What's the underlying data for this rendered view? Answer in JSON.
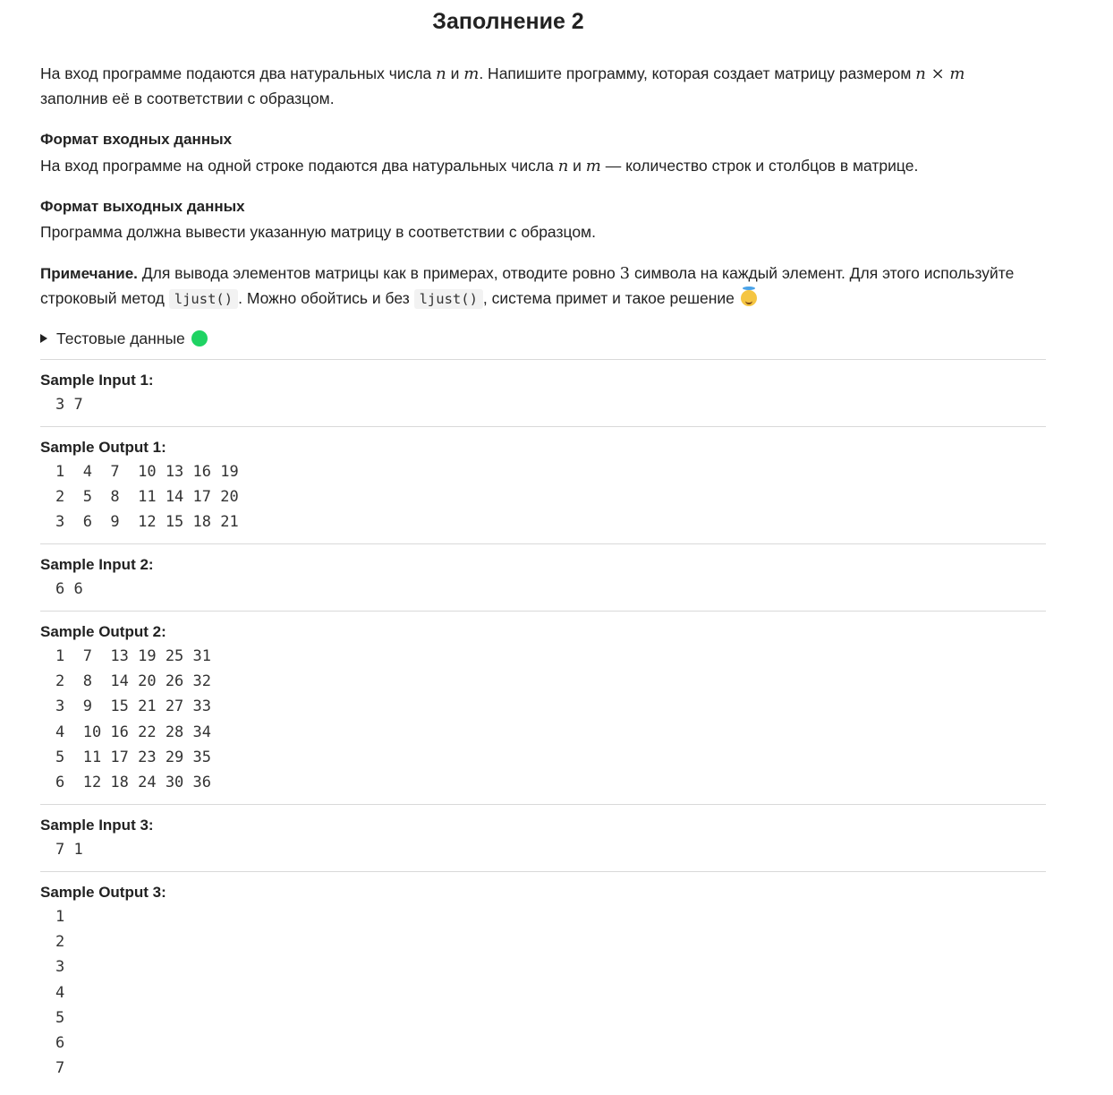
{
  "title": "Заполнение 2",
  "intro": {
    "text1": "На вход программе подаются два натуральных числа ",
    "n": "n",
    "and": " и ",
    "m": "m",
    "text2": ". Напишите программу, которая создает матрицу размером ",
    "times": " × ",
    "line2": "заполнив её в соответствии с образцом."
  },
  "input_format": {
    "heading": "Формат входных данных",
    "text1": "На вход программе на одной строке подаются два натуральных числа ",
    "n": "n",
    "and": " и ",
    "m": "m",
    "text2": " — количество строк и столбцов в матрице."
  },
  "output_format": {
    "heading": "Формат выходных данных",
    "text": "Программа должна вывести указанную матрицу в соответствии с образцом."
  },
  "note": {
    "label": "Примечание.",
    "text1": " Для вывода элементов матрицы как в примерах, отводите ровно ",
    "num": "3",
    "text2": " символа на каждый элемент. Для этого используйте",
    "line2_a": "строковый метод ",
    "code1": "ljust()",
    "line2_b": ". Можно обойтись и без ",
    "code2": "ljust()",
    "line2_c": ", система примет и такое решение",
    "emoji_icon": "smiling-face-with-halo-icon"
  },
  "test_data": {
    "label": "Тестовые данные",
    "status_color": "#1fd363"
  },
  "samples": [
    {
      "label": "Sample Input 1:",
      "text": "3 7"
    },
    {
      "label": "Sample Output 1:",
      "text": "1  4  7  10 13 16 19\n2  5  8  11 14 17 20\n3  6  9  12 15 18 21"
    },
    {
      "label": "Sample Input 2:",
      "text": "6 6"
    },
    {
      "label": "Sample Output 2:",
      "text": "1  7  13 19 25 31\n2  8  14 20 26 32\n3  9  15 21 27 33\n4  10 16 22 28 34\n5  11 17 23 29 35\n6  12 18 24 30 36"
    },
    {
      "label": "Sample Input 3:",
      "text": "7 1"
    },
    {
      "label": "Sample Output 3:",
      "text": "1\n2\n3\n4\n5\n6\n7"
    }
  ]
}
